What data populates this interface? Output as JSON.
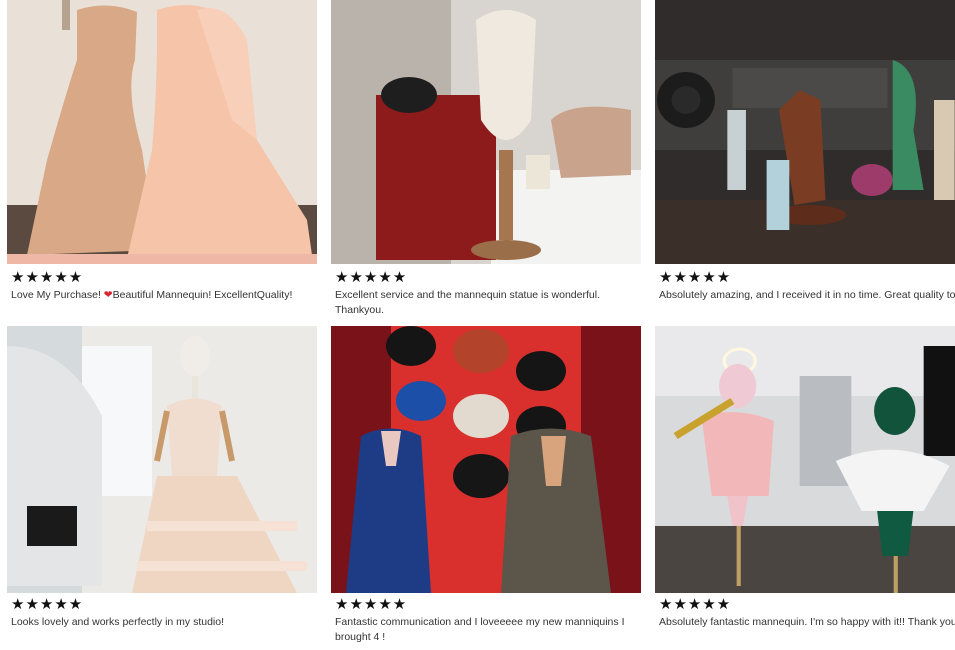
{
  "reviews": [
    {
      "stars": "★★★★★",
      "text_before": "Love My Purchase! ",
      "heart": "❤",
      "text_after": "Beautiful Mannequin! ExcellentQuality!",
      "photo": "two-gowns-on-dress-forms"
    },
    {
      "stars": "★★★★★",
      "text": "Excellent service and the mannequin statue is wonderful. Thankyou.",
      "photo": "tabletop-dress-form-with-binder"
    },
    {
      "stars": "★★★★★",
      "text": "Absolutely amazing, and I received it in no time. Great quality too!",
      "photo": "wooden-hand-on-shelf"
    },
    {
      "stars": "★★★★★",
      "text": "Looks lovely and works perfectly in my studio!",
      "photo": "mannequin-in-ruffled-gown"
    },
    {
      "stars": "★★★★★",
      "text": "Fantastic communication and I loveeeee my new manniquins I brought 4 !",
      "photo": "suited-mannequins-with-hats"
    },
    {
      "stars": "★★★★★",
      "text": "Absolutely fantastic mannequin. I'm so happy with it!! Thank you",
      "photo": "mannequins-in-living-room"
    }
  ]
}
